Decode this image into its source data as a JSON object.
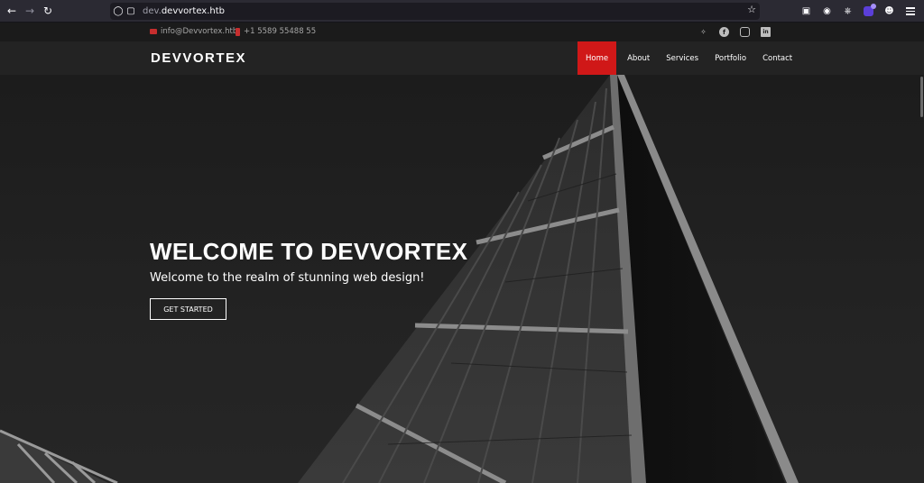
{
  "browser": {
    "url_host_prefix": "dev.",
    "url_host_main": "devvortex.htb",
    "icons": [
      "back-arrow-icon",
      "forward-arrow-icon",
      "reload-icon",
      "shield-icon",
      "lock-icon",
      "bookmark-star-icon",
      "pocket-icon",
      "account-icon",
      "extensions-icon",
      "ublock-icon",
      "panda-icon",
      "menu-icon"
    ]
  },
  "topbar": {
    "email": "info@Devvortex.htb",
    "phone": "+1 5589 55488 55",
    "socials": [
      "twitter-icon",
      "facebook-icon",
      "instagram-icon",
      "linkedin-icon"
    ]
  },
  "header": {
    "logo": "DEVVORTEX",
    "menu": [
      {
        "label": "Home",
        "active": true
      },
      {
        "label": "About",
        "active": false
      },
      {
        "label": "Services",
        "active": false
      },
      {
        "label": "Portfolio",
        "active": false
      },
      {
        "label": "Contact",
        "active": false
      }
    ]
  },
  "hero": {
    "title": "WELCOME TO DEVVORTEX",
    "subtitle": "Welcome to the realm of stunning web design!",
    "cta_label": "GET STARTED"
  },
  "colors": {
    "accent": "#d01818",
    "header_bg": "#232323",
    "topbar_bg": "#1b1b1b",
    "hero_bg": "#1d1d1d"
  }
}
